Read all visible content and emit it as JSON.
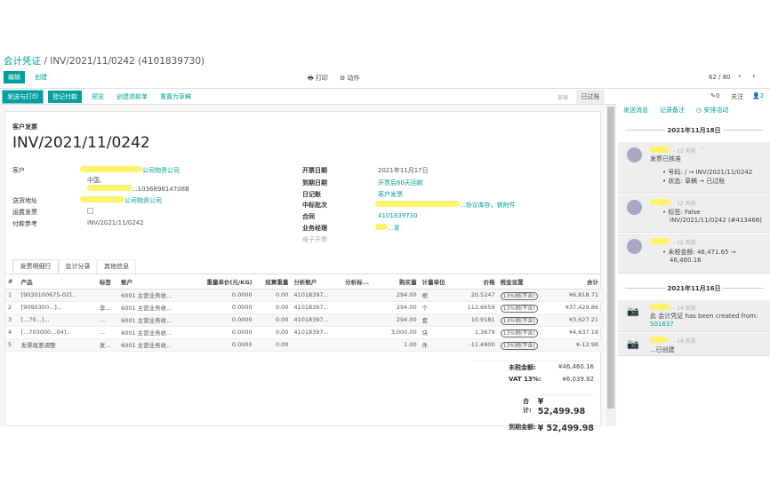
{
  "breadcrumb": {
    "parent": "会计凭证",
    "current": "INV/2021/11/0242 (4101839730)"
  },
  "toolbar": {
    "edit": "编辑",
    "create": "创建",
    "print": "打印",
    "action": "动作",
    "pager": "62 / 80"
  },
  "actions": [
    "发送与打印",
    "登记付款",
    "预览",
    "创建退款单",
    "重置为草稿"
  ],
  "status": {
    "steps": [
      "草稿",
      "已过账"
    ],
    "active": "已过账"
  },
  "form": {
    "type_label": "客户发票",
    "name": "INV/2021/11/0242",
    "left": [
      {
        "label": "客户",
        "value": "公司物资公司",
        "extra": [
          "中国,",
          "...103689814708B"
        ]
      },
      {
        "label": "送货地址",
        "value": "公司物资公司"
      },
      {
        "label": "运费发票",
        "value": ""
      },
      {
        "label": "付款参考",
        "value": "INV/2021/11/0242"
      }
    ],
    "right": [
      {
        "label": "开票日期",
        "value": "2021年11月17日"
      },
      {
        "label": "到期日期",
        "value": "开票后60天回款"
      },
      {
        "label": "日记账",
        "value": "客户发票"
      },
      {
        "label": "中标批次",
        "value": "...协议库存，铁附件"
      },
      {
        "label": "合同",
        "value": "4101839730"
      },
      {
        "label": "业务经理",
        "value": "...青"
      },
      {
        "label": "电子开票",
        "value": ""
      }
    ],
    "tabs": [
      "发票明细行",
      "会计分录",
      "其他信息"
    ],
    "columns": [
      "#",
      "产品",
      "标签",
      "账户",
      "重量单价(元/KG)",
      "结算重量",
      "分析账户",
      "分析标...",
      "购买量",
      "计量单位",
      "价格",
      "税金设置",
      "合计"
    ],
    "rows": [
      [
        "1",
        "[9030100675-02]...",
        "",
        "6001 主营业务收...",
        "0.0000",
        "0.00",
        "41018397...",
        "",
        "294.00",
        "根",
        "20.5247",
        "13%销(不含)",
        "¥6,818.71"
      ],
      [
        "2",
        "[9090300...]...",
        "李...",
        "6001 主营业务收...",
        "0.0000",
        "0.00",
        "41018397...",
        "",
        "294.00",
        "个",
        "112.6659",
        "13%销(不含)",
        "¥37,429.86"
      ],
      [
        "3",
        "[...70...]...",
        "...",
        "6001 主营业务收...",
        "0.0000",
        "0.00",
        "41018397...",
        "",
        "294.00",
        "套",
        "10.9181",
        "13%销(不含)",
        "¥3,627.21"
      ],
      [
        "4",
        "[...703000...04]...",
        "...",
        "6001 主营业务收...",
        "0.0000",
        "0.00",
        "41018397...",
        "",
        "3,000.00",
        "块",
        "1.3679",
        "13%销(不含)",
        "¥4,637.18"
      ],
      [
        "5",
        "发票尾差调整",
        "发...",
        "6001 主营业务收...",
        "0.0000",
        "0.00",
        "",
        "",
        "1.00",
        "件",
        "-11.4900",
        "13%销(不含)",
        "¥-12.98"
      ]
    ],
    "totals": [
      {
        "label": "未税金额:",
        "value": "¥46,460.16"
      },
      {
        "label": "VAT 13%:",
        "value": "¥6,039.82"
      },
      {
        "label": "合计:",
        "value": "¥ 52,499.98"
      },
      {
        "label": "到期金额:",
        "value": "¥ 52,499.98"
      }
    ]
  },
  "chatter": {
    "attachments": "0",
    "follow": "关注",
    "followers": "2",
    "buttons": [
      "发送消息",
      "记录备注",
      "安排活动"
    ],
    "dates": [
      "2021年11月18日",
      "2021年11月16日"
    ],
    "messages": [
      {
        "time": "- 12 天前",
        "body": "发票已核准",
        "items": [
          "号码: / → INV/2021/11/0242",
          "状态: 草稿 → 已过账"
        ]
      },
      {
        "time": "- 12 天前",
        "body": "",
        "items": [
          "标签: False",
          "INV/2021/11/0242 (#413468)"
        ]
      },
      {
        "time": "- 12 天前",
        "body": "",
        "items": [
          "未税金额: 46,471.65 →",
          "46,460.16"
        ]
      },
      {
        "time": "- 14 天前",
        "body": "此 会计凭证 has been created from:",
        "link": "S01637"
      },
      {
        "time": "- 14 天前",
        "body": "...已创建"
      }
    ]
  },
  "colors": {
    "accent": "#00A09D",
    "highlight": "#fff36a"
  }
}
